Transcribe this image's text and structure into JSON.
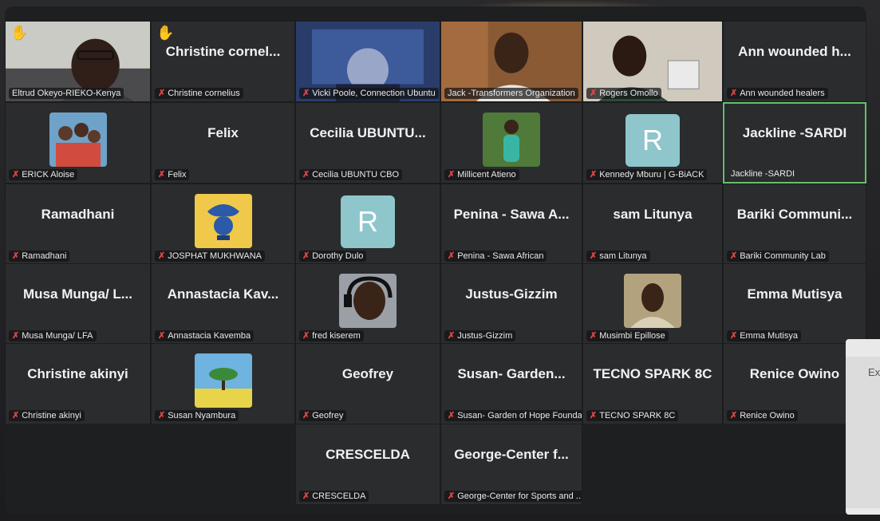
{
  "participants": [
    {
      "id": "t1",
      "label": "Eltrud Okeyo-RIEKO-Kenya",
      "display": "",
      "hand": true,
      "muted": false,
      "video": "woman-glasses"
    },
    {
      "id": "t2",
      "label": "Christine cornelius",
      "display": "Christine cornel...",
      "hand": true,
      "muted": true
    },
    {
      "id": "t3",
      "label": "Vicki Poole, Connection Ubuntu",
      "display": "",
      "hand": false,
      "muted": true,
      "video": "dark-room"
    },
    {
      "id": "t4",
      "label": "Jack -Transformers Organization",
      "display": "",
      "hand": false,
      "muted": false,
      "video": "smiling-man"
    },
    {
      "id": "t5",
      "label": "Rogers Omollo",
      "display": "",
      "hand": false,
      "muted": true,
      "video": "young-man"
    },
    {
      "id": "t6",
      "label": "Ann wounded healers",
      "display": "Ann wounded h...",
      "hand": false,
      "muted": true
    },
    {
      "id": "t7",
      "label": "ERICK Aloise",
      "display": "",
      "hand": false,
      "muted": true,
      "avatar": "group-photo"
    },
    {
      "id": "t8",
      "label": "Felix",
      "display": "Felix",
      "hand": false,
      "muted": true
    },
    {
      "id": "t9",
      "label": "Cecilia UBUNTU CBO",
      "display": "Cecilia UBUNTU...",
      "hand": false,
      "muted": true
    },
    {
      "id": "t10",
      "label": "Millicent Atieno",
      "display": "",
      "hand": false,
      "muted": true,
      "avatar": "woman-photo"
    },
    {
      "id": "t11",
      "label": "Kennedy Mburu | G-BiACK",
      "display": "",
      "hand": false,
      "muted": true,
      "letter": "R"
    },
    {
      "id": "t12",
      "label": "Jackline -SARDI",
      "display": "Jackline -SARDI",
      "hand": false,
      "muted": false,
      "active": true
    },
    {
      "id": "t13",
      "label": "Ramadhani",
      "display": "Ramadhani",
      "hand": false,
      "muted": true
    },
    {
      "id": "t14",
      "label": "JOSPHAT MUKHWANA",
      "display": "",
      "hand": false,
      "muted": true,
      "avatar": "bird-logo"
    },
    {
      "id": "t15",
      "label": "Dorothy Dulo",
      "display": "",
      "hand": false,
      "muted": true,
      "letter": "R"
    },
    {
      "id": "t16",
      "label": "Penina - Sawa African",
      "display": "Penina - Sawa A...",
      "hand": false,
      "muted": true
    },
    {
      "id": "t17",
      "label": "sam Litunya",
      "display": "sam Litunya",
      "hand": false,
      "muted": true
    },
    {
      "id": "t18",
      "label": "Bariki Community Lab",
      "display": "Bariki Communi...",
      "hand": false,
      "muted": true
    },
    {
      "id": "t19",
      "label": "Musa Munga/ LFA",
      "display": "Musa Munga/ L...",
      "hand": false,
      "muted": true
    },
    {
      "id": "t20",
      "label": "Annastacia Kavemba",
      "display": "Annastacia Kav...",
      "hand": false,
      "muted": true
    },
    {
      "id": "t21",
      "label": "fred kiserem",
      "display": "",
      "hand": false,
      "muted": true,
      "avatar": "man-headset"
    },
    {
      "id": "t22",
      "label": "Justus-Gizzim",
      "display": "Justus-Gizzim",
      "hand": false,
      "muted": true
    },
    {
      "id": "t23",
      "label": "Musimbi Epillose",
      "display": "",
      "hand": false,
      "muted": true,
      "avatar": "woman-smiling"
    },
    {
      "id": "t24",
      "label": "Emma Mutisya",
      "display": "Emma Mutisya",
      "hand": false,
      "muted": true
    },
    {
      "id": "t25",
      "label": "Christine akinyi",
      "display": "Christine akinyi",
      "hand": false,
      "muted": true
    },
    {
      "id": "t26",
      "label": "Susan Nyambura",
      "display": "",
      "hand": false,
      "muted": true,
      "avatar": "tree-painting"
    },
    {
      "id": "t27",
      "label": "Geofrey",
      "display": "Geofrey",
      "hand": false,
      "muted": true
    },
    {
      "id": "t28",
      "label": "Susan- Garden of Hope Founda...",
      "display": "Susan- Garden...",
      "hand": false,
      "muted": true
    },
    {
      "id": "t29",
      "label": "TECNO SPARK 8C",
      "display": "TECNO SPARK 8C",
      "hand": false,
      "muted": true
    },
    {
      "id": "t30",
      "label": "Renice Owino",
      "display": "Renice Owino",
      "hand": false,
      "muted": true
    },
    {
      "id": "t31",
      "label": "CRESCELDA",
      "display": "CRESCELDA",
      "hand": false,
      "muted": true
    },
    {
      "id": "t32",
      "label": "George-Center for Sports and ...",
      "display": "George-Center f...",
      "hand": false,
      "muted": true
    }
  ],
  "side_panel": {
    "text": "Ex"
  },
  "colors": {
    "active_border": "#61c26c",
    "mic_muted": "#e0464b",
    "hand": "#f5c518",
    "avatar_letter_bg": "#8ec6cc"
  },
  "icons": {
    "muted_mic": "mic-off-icon",
    "raised_hand": "raised-hand-icon"
  }
}
